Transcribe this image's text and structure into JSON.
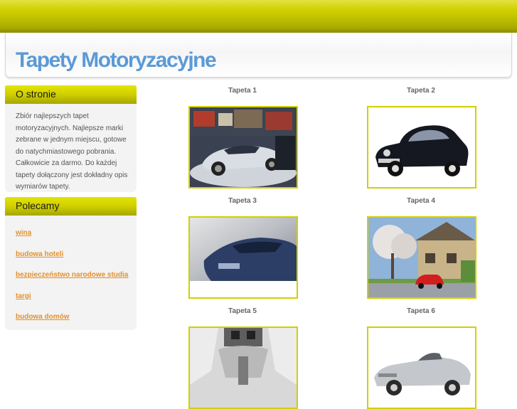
{
  "header": {
    "title": "Tapety Motoryzacyjne"
  },
  "sidebar": {
    "about": {
      "heading": "O stronie",
      "text": "Zbiór najlepszych tapet motoryzacyjnych. Najlepsze marki zebrane w jednym miejscu, gotowe do natychmiastowego pobrania. Całkowicie za darmo. Do każdej tapety dołączony jest dokładny opis wymiarów tapety."
    },
    "recommend": {
      "heading": "Polecamy",
      "links": [
        "wina",
        "budowa hoteli",
        "bezpieczeństwo narodowe studia",
        "targi",
        "budowa domów"
      ]
    }
  },
  "wallpapers": [
    {
      "label": "Tapeta 1"
    },
    {
      "label": "Tapeta 2"
    },
    {
      "label": "Tapeta 3"
    },
    {
      "label": "Tapeta 4"
    },
    {
      "label": "Tapeta 5"
    },
    {
      "label": "Tapeta 6"
    }
  ],
  "colors": {
    "accent_yellow": "#cccc00",
    "title_blue": "#5b9ad6",
    "link_orange": "#e4902a"
  }
}
